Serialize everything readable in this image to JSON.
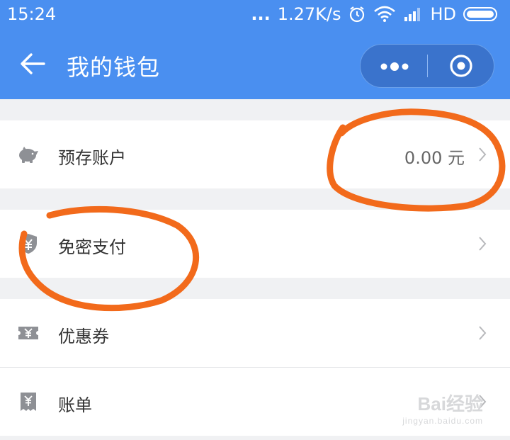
{
  "status_bar": {
    "time": "15:24",
    "dots": "...",
    "speed": "1.27K/s",
    "network": "HD"
  },
  "nav": {
    "title": "我的钱包"
  },
  "rows": [
    {
      "label": "预存账户",
      "value": "0.00 元",
      "icon": "piggy-bank-icon"
    },
    {
      "label": "免密支付",
      "icon": "shield-yuan-icon"
    },
    {
      "label": "优惠券",
      "icon": "coupon-icon"
    },
    {
      "label": "账单",
      "icon": "bill-icon"
    }
  ],
  "watermark": {
    "logo": "Bai经验",
    "url": "jingyan.baidu.com"
  },
  "colors": {
    "brand_blue": "#4a8ff0",
    "annotation_orange": "#f26a1b"
  }
}
